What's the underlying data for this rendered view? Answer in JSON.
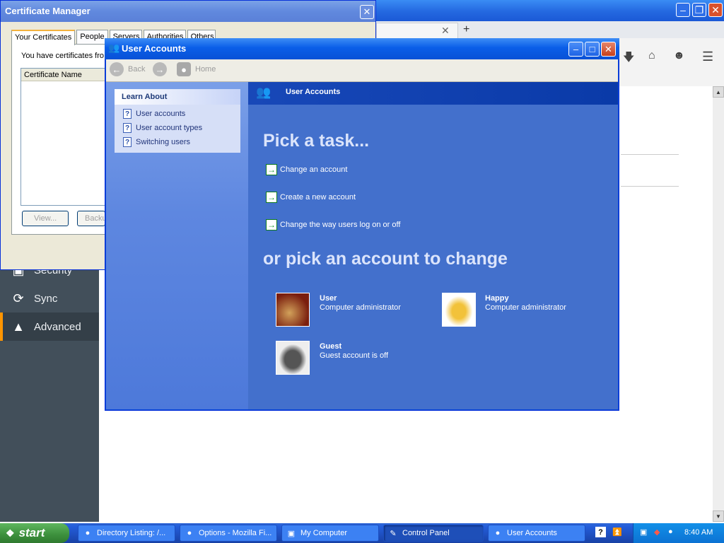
{
  "firefox": {
    "sidebar": [
      {
        "label": "Security",
        "icon": "lock-icon"
      },
      {
        "label": "Sync",
        "icon": "sync-icon"
      },
      {
        "label": "Advanced",
        "icon": "wizard-hat-icon"
      }
    ]
  },
  "cert_manager": {
    "title": "Certificate Manager",
    "tabs": [
      "Your Certificates",
      "People",
      "Servers",
      "Authorities",
      "Others"
    ],
    "description": "You have certificates fro",
    "column": "Certificate Name",
    "buttons": [
      "View...",
      "Backu"
    ]
  },
  "user_accounts": {
    "title": "User Accounts",
    "nav": {
      "back": "Back",
      "home": "Home"
    },
    "learn_about": {
      "heading": "Learn About",
      "items": [
        "User accounts",
        "User account types",
        "Switching users"
      ]
    },
    "header": "User Accounts",
    "pick_task": "Pick a task...",
    "tasks": [
      "Change an account",
      "Create a new account",
      "Change the way users log on or off"
    ],
    "pick_account": "or pick an account to change",
    "accounts": [
      {
        "name": "User",
        "type": "Computer administrator"
      },
      {
        "name": "Happy",
        "type": "Computer administrator"
      },
      {
        "name": "Guest",
        "type": "Guest account is off"
      }
    ]
  },
  "taskbar": {
    "start": "start",
    "items": [
      {
        "label": "Directory Listing: /...",
        "icon": "folder-icon"
      },
      {
        "label": "Options - Mozilla Fi...",
        "icon": "firefox-icon"
      },
      {
        "label": "My Computer",
        "icon": "computer-icon"
      },
      {
        "label": "Control Panel",
        "icon": "control-panel-icon"
      },
      {
        "label": "User Accounts",
        "icon": "users-icon"
      }
    ],
    "clock": "8:40 AM"
  },
  "colors": {
    "xp_blue": "#0a47d8",
    "panel_blue": "#4370cc",
    "firefox_sidebar": "#424f5a",
    "firefox_accent": "#ff9500",
    "start_green": "#3c8f3c"
  }
}
